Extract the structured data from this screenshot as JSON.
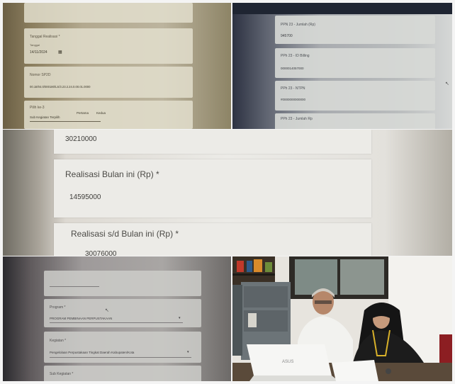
{
  "panel_top_left": {
    "tanggal_label": "Tanggal Realisasi *",
    "tanggal_sublabel": "Tanggal",
    "tanggal_value": "14/11/2024",
    "nomor_label": "Nomor SP2D",
    "nomor_value": "00.18/04.0/000180/LS/3.23.2.24.0.00.01.0000",
    "pilih_label": "Pilih ke-3",
    "opt_a": "Pertama",
    "opt_b": "Kedua",
    "pilih_value": "Sub Kegiatan Terpilih"
  },
  "panel_top_right": {
    "card1_label": "PPN 23 - Jumlah (Rp)",
    "card1_value": "945700",
    "card2_label": "PPh 23 - ID Billing",
    "card2_value": "0000014057000",
    "card3_label": "PPh 23 - NTPN",
    "card3_value": "#0000000000000",
    "card4_label": "PPh 23 - Jumlah Rp"
  },
  "panel_middle": {
    "top_value": "30210000",
    "field1_label": "Realisasi Bulan ini (Rp) *",
    "field1_value": "14595000",
    "field2_label": "Realisasi s/d Bulan ini (Rp) *",
    "field2_value": "30076000"
  },
  "panel_bottom_left": {
    "program_label": "Program *",
    "program_value": "PROGRAM PEMBINAAN PERPUSTAKAAN",
    "kegiatan_label": "Kegiatan *",
    "kegiatan_value": "Pengelolaan Perpustakaan Tingkat Daerah Kabupaten/Kota",
    "subkegiatan_label": "Sub Kegiatan *"
  },
  "photo": {
    "laptop_brand": "ASUS"
  }
}
